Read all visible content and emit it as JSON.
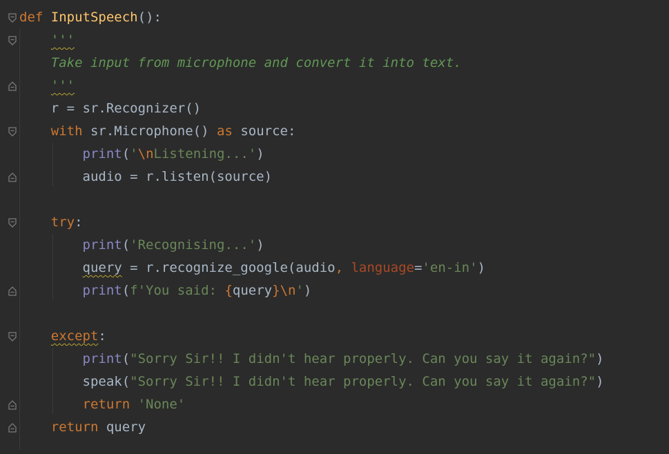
{
  "editor": {
    "language": "python",
    "colors": {
      "background": "#2b2b2b",
      "keyword": "#cc7832",
      "function_name": "#ffc66d",
      "string": "#6a8759",
      "docstring": "#629755",
      "builtin": "#8888c6",
      "parameter": "#aa4926",
      "default_text": "#a9b7c6",
      "warning_squiggle": "#b8a432"
    },
    "fold_icons": [
      "fold-open-icon",
      "fold-close-icon"
    ],
    "lines": {
      "l1": {
        "kw_def": "def",
        "fn_name": "InputSpeech",
        "rest": "():"
      },
      "l2": {
        "doc_open": "'''"
      },
      "l3": {
        "doc_text": "Take input from microphone and convert it into text."
      },
      "l4": {
        "doc_close": "'''"
      },
      "l5": {
        "code": "r = sr.Recognizer()"
      },
      "l6": {
        "kw_with": "with",
        "mid": " sr.Microphone() ",
        "kw_as": "as",
        "end": " source:"
      },
      "l7": {
        "builtin": "print",
        "paren_open": "(",
        "quote_open": "'",
        "escape": "\\n",
        "str_rest": "Listening...'",
        "paren_close": ")"
      },
      "l8": {
        "code": "audio = r.listen(source)"
      },
      "l10": {
        "kw_try": "try",
        "colon": ":"
      },
      "l11": {
        "builtin": "print",
        "paren_open": "(",
        "str": "'Recognising...'",
        "paren_close": ")"
      },
      "l12": {
        "var": "query",
        "mid": " = r.recognize_google(audio",
        "comma": ", ",
        "param": "language",
        "eq": "=",
        "str": "'en-in'",
        "paren_close": ")"
      },
      "l13": {
        "builtin": "print",
        "paren_open": "(",
        "str_open": "f'You said: ",
        "brace_open": "{",
        "var": "query",
        "brace_close": "}",
        "escape": "\\n",
        "str_close": "'",
        "paren_close": ")"
      },
      "l15": {
        "kw_except": "except",
        "colon": ":"
      },
      "l16": {
        "builtin": "print",
        "paren_open": "(",
        "str": "\"Sorry Sir!! I didn't hear properly. Can you say it again?\"",
        "paren_close": ")"
      },
      "l17": {
        "fn": "speak",
        "paren_open": "(",
        "str": "\"Sorry Sir!! I didn't hear properly. Can you say it again?\"",
        "paren_close": ")"
      },
      "l18": {
        "kw_return": "return",
        "space": " ",
        "str": "'None'"
      },
      "l19": {
        "kw_return": "return",
        "rest": " query"
      }
    }
  }
}
